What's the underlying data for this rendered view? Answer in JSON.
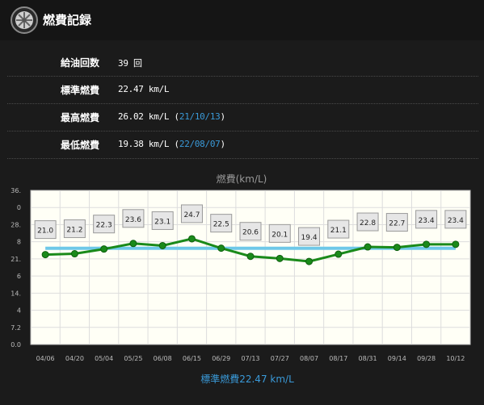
{
  "header": {
    "title": "燃費記録",
    "icon": "wheel-icon"
  },
  "summary": {
    "refuel_count": {
      "label": "給油回数",
      "value": "39",
      "unit": "回"
    },
    "standard": {
      "label": "標準燃費",
      "value": "22.47 km/L"
    },
    "best": {
      "label": "最高燃費",
      "value": "26.02 km/L",
      "open": " (",
      "date": "21/10/13",
      "close": ")"
    },
    "worst": {
      "label": "最低燃費",
      "value": "19.38 km/L",
      "open": " (",
      "date": "22/08/07",
      "close": ")"
    }
  },
  "colors": {
    "series": "#1a8a1a",
    "standard_line": "#6ec8e8",
    "link": "#3a9ad9",
    "plot_bg": "#fffff6"
  },
  "chart_data": {
    "type": "line",
    "title": "燃費(km/L)",
    "y_tick_labels": [
      "36.",
      "0",
      "28.",
      "8",
      "21.",
      "6",
      "14.",
      "4",
      "7.2",
      "0.0"
    ],
    "ylim": [
      0,
      36
    ],
    "x": [
      "04/06",
      "04/20",
      "05/04",
      "05/25",
      "06/08",
      "06/15",
      "06/29",
      "07/13",
      "07/27",
      "08/07",
      "08/17",
      "08/31",
      "09/14",
      "09/28",
      "10/12"
    ],
    "series": [
      {
        "values": [
          21.0,
          21.2,
          22.3,
          23.6,
          23.1,
          24.7,
          22.5,
          20.6,
          20.1,
          19.4,
          21.1,
          22.8,
          22.7,
          23.4,
          23.4
        ]
      }
    ],
    "data_labels": [
      "21.0",
      "21.2",
      "22.3",
      "23.6",
      "23.1",
      "24.7",
      "22.5",
      "20.6",
      "20.1",
      "19.4",
      "21.1",
      "22.8",
      "22.7",
      "23.4",
      "23.4"
    ],
    "standard_value": 22.47,
    "legend": "標準燃費22.47 km/L",
    "grid": true
  }
}
